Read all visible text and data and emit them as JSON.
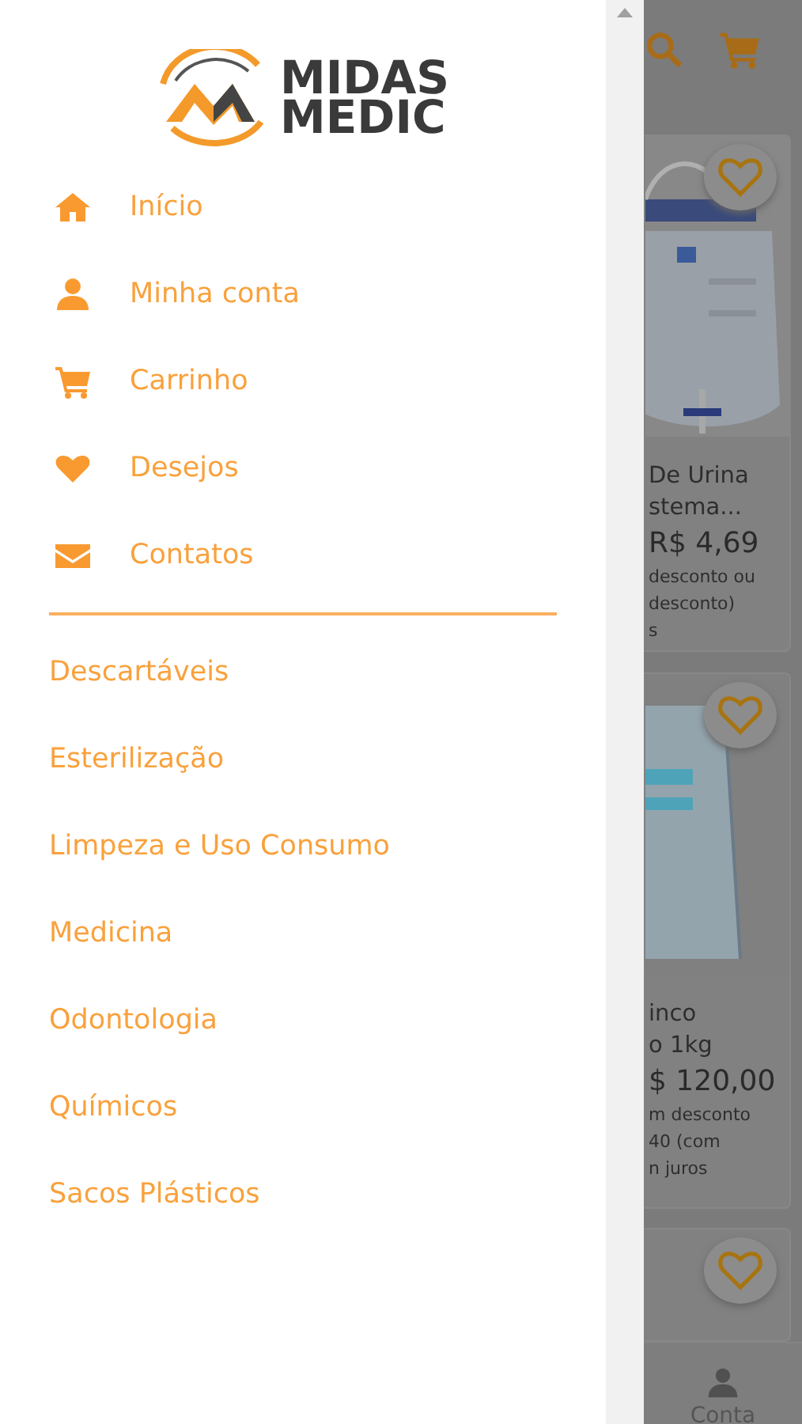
{
  "logo": {
    "lines": [
      "MIDAS",
      "MEDIC"
    ]
  },
  "menu": [
    {
      "kind": "home",
      "label": "Início"
    },
    {
      "kind": "user",
      "label": "Minha conta"
    },
    {
      "kind": "cart",
      "label": "Carrinho"
    },
    {
      "kind": "heart",
      "label": "Desejos"
    },
    {
      "kind": "mail",
      "label": "Contatos"
    }
  ],
  "categories": [
    "Descartáveis",
    "Esterilização",
    "Limpeza e Uso Consumo",
    "Medicina",
    "Odontologia",
    "Químicos",
    "Sacos Plásticos"
  ],
  "background_page": {
    "cards": [
      {
        "kind": "bag",
        "name_lines": [
          "De Urina",
          "stema..."
        ],
        "price": "R$ 4,69",
        "note_lines": [
          "desconto ou",
          "desconto)",
          "s"
        ]
      },
      {
        "kind": "pack",
        "name_lines": [
          "inco",
          "o 1kg"
        ],
        "price": "$ 120,00",
        "note_lines": [
          "m desconto",
          "40 (com",
          "n juros"
        ]
      },
      {
        "kind": "empty"
      }
    ],
    "bottom_nav": {
      "label": "Conta"
    }
  }
}
